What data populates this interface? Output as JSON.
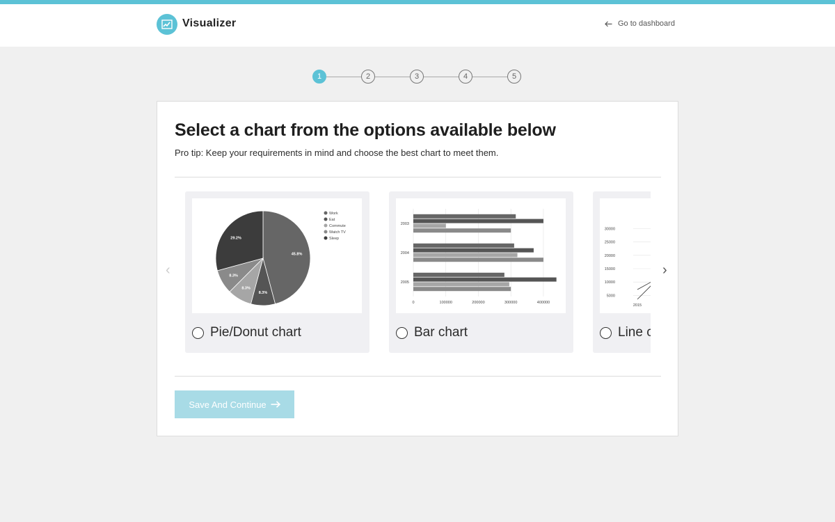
{
  "header": {
    "brand": "Visualizer",
    "back_link": "Go to dashboard",
    "accent_color": "#5cc2d6"
  },
  "stepper": {
    "steps": [
      "1",
      "2",
      "3",
      "4",
      "5"
    ],
    "active_step": 1
  },
  "main": {
    "title": "Select a chart from the options available below",
    "tip": "Pro tip: Keep your requirements in mind and choose the best chart to meet them.",
    "save_label": "Save And Continue"
  },
  "options": [
    {
      "label": "Pie/Donut chart",
      "selected": false,
      "chart_data": {
        "type": "pie",
        "legend": [
          "Work",
          "Eat",
          "Commute",
          "Watch TV",
          "Sleep"
        ],
        "values": [
          45.8,
          8.3,
          8.3,
          8.3,
          29.2
        ],
        "slice_labels": [
          "45.8%",
          "8.3%",
          "8.3%",
          "8.3%",
          "29.2%"
        ],
        "colors": [
          "#666666",
          "#555555",
          "#a6a6a6",
          "#8a8a8a",
          "#3c3c3c"
        ],
        "legend_position": "right"
      }
    },
    {
      "label": "Bar chart",
      "selected": false,
      "chart_data": {
        "type": "bar",
        "orientation": "horizontal",
        "categories": [
          "2003",
          "2004",
          "2005"
        ],
        "series": [
          {
            "values": [
              315000,
              310000,
              280000
            ],
            "color": "#666666"
          },
          {
            "values": [
              400000,
              370000,
              440000
            ],
            "color": "#555555"
          },
          {
            "values": [
              100000,
              320000,
              295000
            ],
            "color": "#a6a6a6"
          },
          {
            "values": [
              300000,
              400000,
              300000
            ],
            "color": "#8a8a8a"
          }
        ],
        "x_ticks": [
          "0",
          "100000",
          "200000",
          "300000",
          "400000"
        ],
        "xlim": [
          0,
          460000
        ]
      }
    },
    {
      "label": "Line chart",
      "selected": false,
      "chart_data": {
        "type": "line",
        "y_ticks": [
          "30000",
          "25000",
          "20000",
          "15000",
          "10000",
          "5000"
        ],
        "x_ticks": [
          "2015"
        ],
        "ylim": [
          3000,
          33000
        ]
      }
    }
  ]
}
